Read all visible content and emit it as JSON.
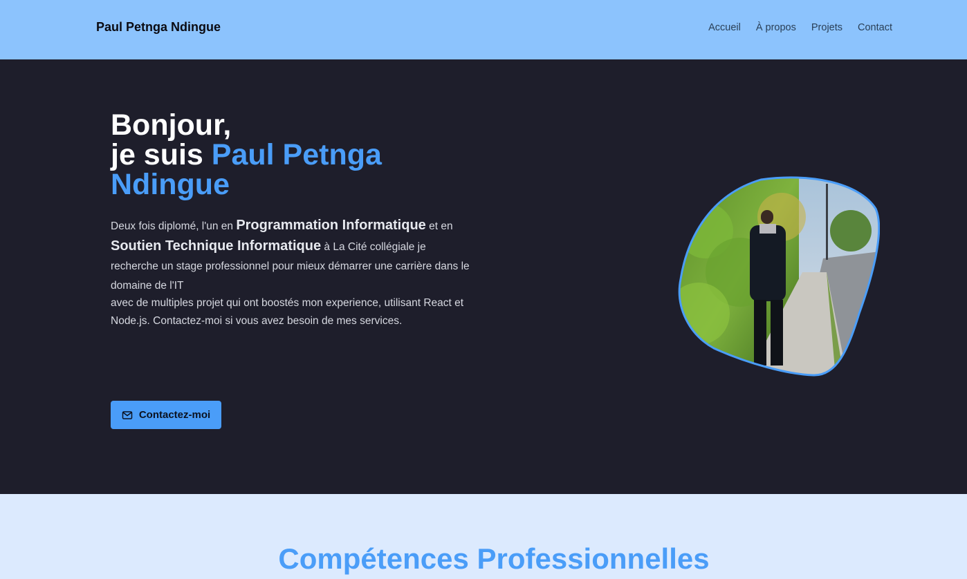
{
  "nav": {
    "brand": "Paul Petnga Ndingue",
    "links": [
      "Accueil",
      "À propos",
      "Projets",
      "Contact"
    ]
  },
  "hero": {
    "greeting": "Bonjour,",
    "intro": "je suis ",
    "name_line1": "Paul Petnga",
    "name_line2": "Ndingue",
    "desc_part1": "Deux fois diplomé, l'un en ",
    "desc_highlight1": "Programmation Informatique",
    "desc_part2": " et en ",
    "desc_highlight2": "Soutien Technique Informatique",
    "desc_part3": " à La Cité collégiale je recherche un stage professionnel pour mieux démarrer une carrière dans le domaine de l'IT",
    "desc_line2": "avec de multiples projet qui ont boostés mon experience, utilisant React et Node.js. Contactez-moi si vous avez besoin de mes services.",
    "cta_label": "Contactez-moi",
    "cta_icon": "mail-icon"
  },
  "skills": {
    "title": "Compétences Professionnelles"
  },
  "colors": {
    "nav_bg": "#8cc3fd",
    "hero_bg": "#1e1e2b",
    "accent": "#4a9df8",
    "skills_bg": "#dceafe"
  }
}
